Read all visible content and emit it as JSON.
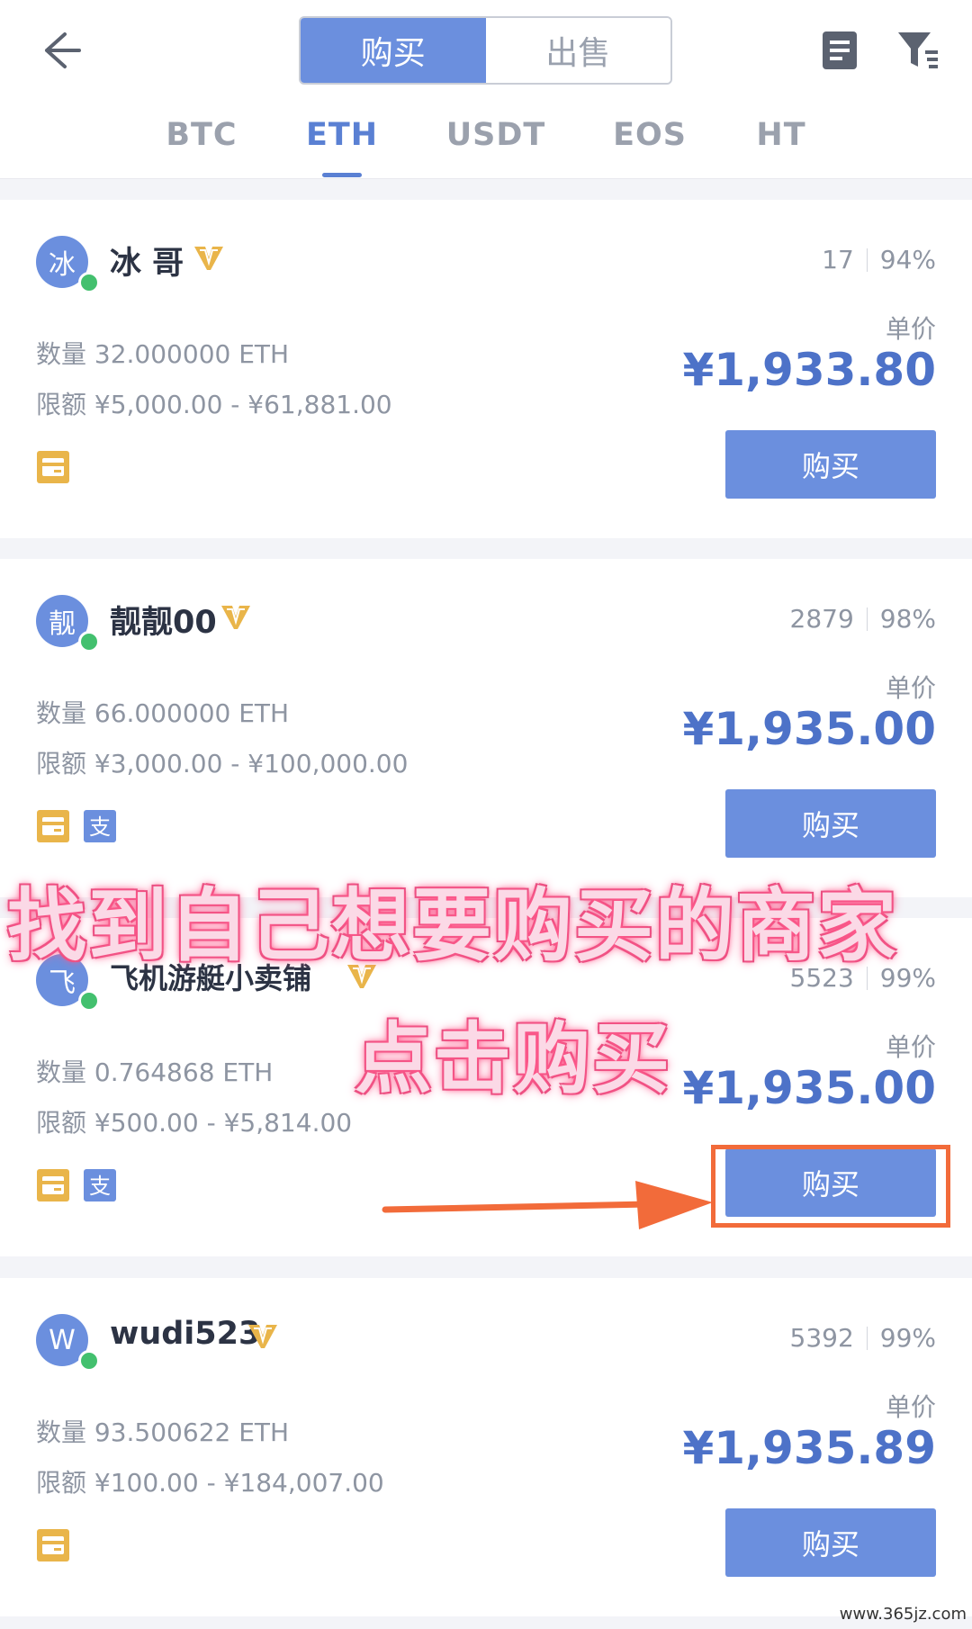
{
  "header": {
    "segments": [
      {
        "label": "购买",
        "active": true
      },
      {
        "label": "出售",
        "active": false
      }
    ],
    "icons": {
      "back": "back-arrow-icon",
      "doc": "document-icon",
      "filter": "filter-icon"
    }
  },
  "tabs": [
    {
      "label": "BTC",
      "active": false
    },
    {
      "label": "ETH",
      "active": true
    },
    {
      "label": "USDT",
      "active": false
    },
    {
      "label": "EOS",
      "active": false
    },
    {
      "label": "HT",
      "active": false
    }
  ],
  "listings": [
    {
      "avatar": "冰",
      "name": "冰 哥",
      "orders": "17",
      "rate": "94%",
      "price_label": "单价",
      "price": "¥1,933.80",
      "qty": "数量 32.000000 ETH",
      "limit": "限额 ¥5,000.00 - ¥61,881.00",
      "buy_label": "购买",
      "payments": [
        "bank-card"
      ]
    },
    {
      "avatar": "靓",
      "name": "靓靓00",
      "orders": "2879",
      "rate": "98%",
      "price_label": "单价",
      "price": "¥1,935.00",
      "qty": "数量 66.000000 ETH",
      "limit": "限额 ¥3,000.00 - ¥100,000.00",
      "buy_label": "购买",
      "payments": [
        "bank-card",
        "alipay"
      ]
    },
    {
      "avatar": "飞",
      "name": "飞机游艇小卖铺",
      "orders": "5523",
      "rate": "99%",
      "price_label": "单价",
      "price": "¥1,935.00",
      "qty": "数量 0.764868 ETH",
      "limit": "限额 ¥500.00 - ¥5,814.00",
      "buy_label": "购买",
      "payments": [
        "bank-card",
        "alipay"
      ]
    },
    {
      "avatar": "W",
      "name": "wudi523",
      "orders": "5392",
      "rate": "99%",
      "price_label": "单价",
      "price": "¥1,935.89",
      "qty": "数量 93.500622 ETH",
      "limit": "限额 ¥100.00 - ¥184,007.00",
      "buy_label": "购买",
      "payments": [
        "bank-card"
      ]
    }
  ],
  "overlay": {
    "line1": "找到自己想要购买的商家",
    "line2": "点击购买"
  },
  "watermark": "www.365jz.com",
  "colors": {
    "accent": "#6b8fde",
    "online": "#43c06e",
    "vip": "#e9b54a",
    "highlight": "#f26b3a"
  }
}
